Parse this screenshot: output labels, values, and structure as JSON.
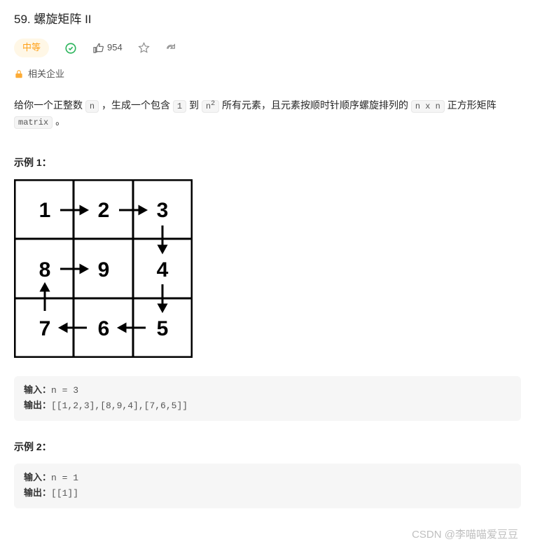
{
  "title": "59. 螺旋矩阵 II",
  "difficulty": "中等",
  "likes": "954",
  "company_tag": "相关企业",
  "description": {
    "pre1": "给你一个正整数 ",
    "code1": "n",
    "mid1": " ，生成一个包含 ",
    "code2": "1",
    "mid2": " 到 ",
    "code3_base": "n",
    "code3_exp": "2",
    "mid3": " 所有元素，且元素按顺时针顺序螺旋排列的 ",
    "code4": "n x n",
    "mid4": " 正方形矩阵 ",
    "code5": "matrix",
    "post": " 。"
  },
  "example1": {
    "heading": "示例 1：",
    "input_label": "输入：",
    "input_value": "n = 3",
    "output_label": "输出：",
    "output_value": "[[1,2,3],[8,9,4],[7,6,5]]"
  },
  "example2": {
    "heading": "示例 2：",
    "input_label": "输入：",
    "input_value": "n = 1",
    "output_label": "输出：",
    "output_value": "[[1]]"
  },
  "spiral": {
    "cells": [
      "1",
      "2",
      "3",
      "8",
      "9",
      "4",
      "7",
      "6",
      "5"
    ]
  },
  "watermark": "CSDN @李喵喵爱豆豆"
}
